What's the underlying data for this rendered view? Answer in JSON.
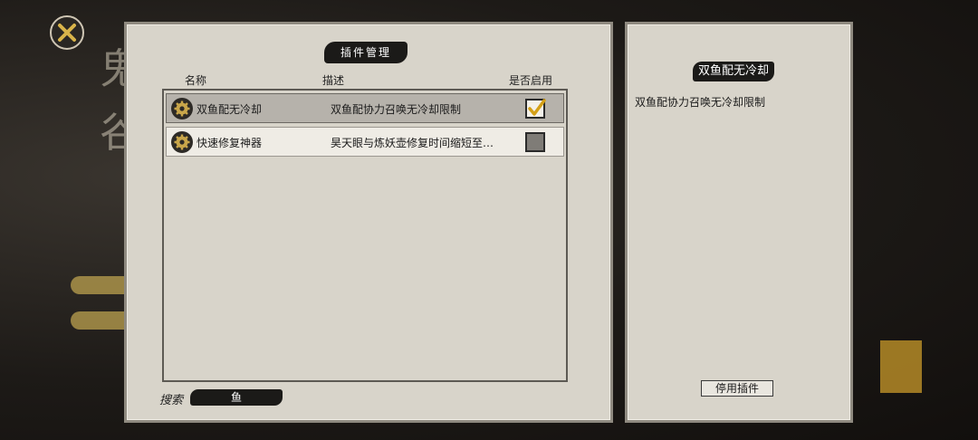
{
  "window": {
    "title": "插件管理"
  },
  "columns": {
    "name": "名称",
    "description": "描述",
    "enabled": "是否启用"
  },
  "plugins": [
    {
      "name": "双鱼配无冷却",
      "description": "双鱼配协力召唤无冷却限制",
      "enabled": true,
      "selected": true
    },
    {
      "name": "快速修复神器",
      "description": "昊天眼与炼妖壶修复时间缩短至…",
      "enabled": false,
      "selected": false
    }
  ],
  "search": {
    "label": "搜索",
    "value": "鱼"
  },
  "detail": {
    "title": "双鱼配无冷却",
    "description": "双鱼配协力召唤无冷却限制",
    "disable_button": "停用插件"
  },
  "icons": {
    "close": "close-x-icon",
    "plugin": "gear-icon",
    "check": "checkmark-icon"
  },
  "colors": {
    "panel": "#d8d4ca",
    "selected_row": "#b6b2ab",
    "check": "#d4a017"
  }
}
